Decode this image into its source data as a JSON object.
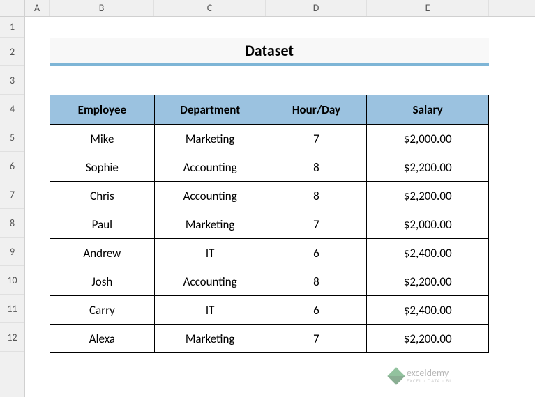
{
  "columns": [
    "A",
    "B",
    "C",
    "D",
    "E"
  ],
  "rows": [
    "1",
    "2",
    "3",
    "4",
    "5",
    "6",
    "7",
    "8",
    "9",
    "10",
    "11",
    "12"
  ],
  "title": "Dataset",
  "table": {
    "headers": {
      "employee": "Employee",
      "department": "Department",
      "hourday": "Hour/Day",
      "salary": "Salary"
    },
    "data": [
      {
        "employee": "Mike",
        "department": "Marketing",
        "hourday": "7",
        "salary": "$2,000.00"
      },
      {
        "employee": "Sophie",
        "department": "Accounting",
        "hourday": "8",
        "salary": "$2,200.00"
      },
      {
        "employee": "Chris",
        "department": "Accounting",
        "hourday": "8",
        "salary": "$2,200.00"
      },
      {
        "employee": "Paul",
        "department": "Marketing",
        "hourday": "7",
        "salary": "$2,000.00"
      },
      {
        "employee": "Andrew",
        "department": "IT",
        "hourday": "6",
        "salary": "$2,400.00"
      },
      {
        "employee": "Josh",
        "department": "Accounting",
        "hourday": "8",
        "salary": "$2,200.00"
      },
      {
        "employee": "Carry",
        "department": "IT",
        "hourday": "6",
        "salary": "$2,400.00"
      },
      {
        "employee": "Alexa",
        "department": "Marketing",
        "hourday": "7",
        "salary": "$2,200.00"
      }
    ]
  },
  "watermark": {
    "title": "exceldemy",
    "sub": "EXCEL · DATA · BI"
  }
}
